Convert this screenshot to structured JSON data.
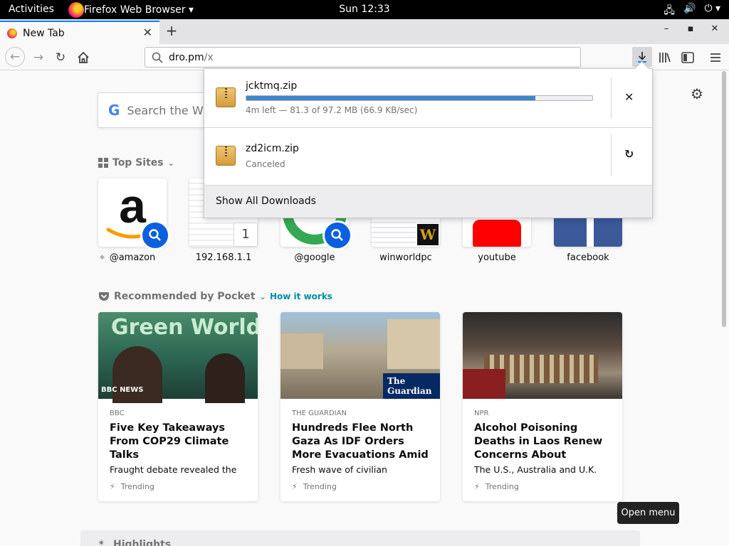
{
  "topbar": {
    "activities": "Activities",
    "app_name": "Firefox Web Browser ▾",
    "clock": "Sun 12:33",
    "icons": [
      "network-icon",
      "volume-icon",
      "power-icon"
    ]
  },
  "tab": {
    "title": "New Tab",
    "close": "✕"
  },
  "newtab_button": "+",
  "window_controls": {
    "minimize": "–",
    "maximize": "▪",
    "close": "✕"
  },
  "urlbar": {
    "host": "dro.pm",
    "path": "/x"
  },
  "search": {
    "placeholder": "Search the W",
    "engine_logo": "G"
  },
  "top_sites": {
    "heading": "Top Sites",
    "tiles": [
      {
        "label": "@amazon"
      },
      {
        "label": "192.168.1.1",
        "badge": "1"
      },
      {
        "label": "@google"
      },
      {
        "label": "winworldpc",
        "badge": "W"
      },
      {
        "label": "youtube"
      },
      {
        "label": "facebook"
      }
    ]
  },
  "pocket": {
    "heading": "Recommended by Pocket",
    "how_it_works": "How it works",
    "cards": [
      {
        "source": "BBC",
        "title": "Five Key Takeaways From COP29 Climate Talks",
        "excerpt": "Fraught debate revealed the",
        "trend": "Trending",
        "image_text": "Green World",
        "logo": "BBC NEWS"
      },
      {
        "source": "THE GUARDIAN",
        "title": "Hundreds Flee North Gaza As IDF Orders More Evacuations Amid",
        "excerpt": "Fresh wave of civilian",
        "trend": "Trending",
        "logo": "The Guardian"
      },
      {
        "source": "NPR",
        "title": "Alcohol Poisoning Deaths in Laos Renew Concerns About",
        "excerpt": "The U.S., Australia and U.K.",
        "trend": "Trending"
      }
    ]
  },
  "highlights": {
    "heading": "Highlights"
  },
  "tooltip": "Open menu",
  "downloads": {
    "items": [
      {
        "name": "jcktmq.zip",
        "status": "4m left — 81.3 of 97.2 MB (66.9 KB/sec)",
        "progress": 0.836,
        "action": "✕"
      },
      {
        "name": "zd2icm.zip",
        "status": "Canceled",
        "action": "↻"
      }
    ],
    "show_all": "Show All Downloads"
  },
  "colors": {
    "accent": "#0a84ff",
    "progress": "#3d86cc",
    "pocket_link": "#008ea4"
  }
}
